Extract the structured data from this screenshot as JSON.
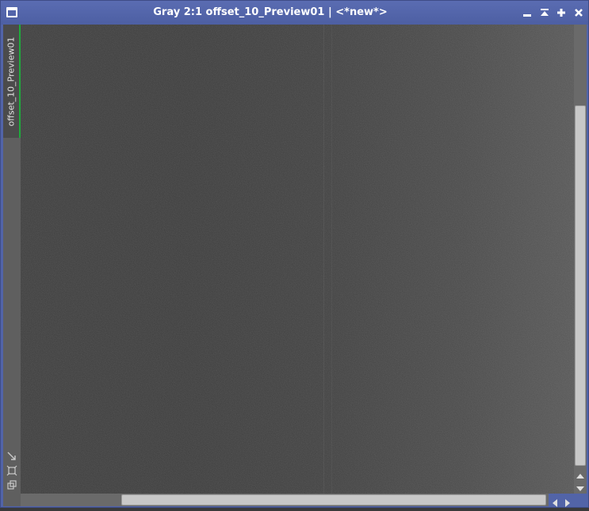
{
  "window": {
    "title": "Gray 2:1 offset_10_Preview01 | <*new*>",
    "buttons": {
      "minimize": "−",
      "shade": "⏶",
      "maximize": "+",
      "close": "×"
    },
    "icons": {
      "app": "window-icon",
      "minimize": "minimize-icon",
      "shade": "shade-icon",
      "maximize": "maximize-icon",
      "close": "close-icon"
    }
  },
  "preview_tab": {
    "label": "offset_10_Preview01"
  },
  "side_tools": [
    "new-preview-icon",
    "fit-view-icon",
    "clone-icon",
    "target-icon"
  ],
  "colors": {
    "titlebar": "#5264a8",
    "active_tab_indicator": "#1faa3c",
    "scroll_thumb": "#c8c8c8"
  }
}
